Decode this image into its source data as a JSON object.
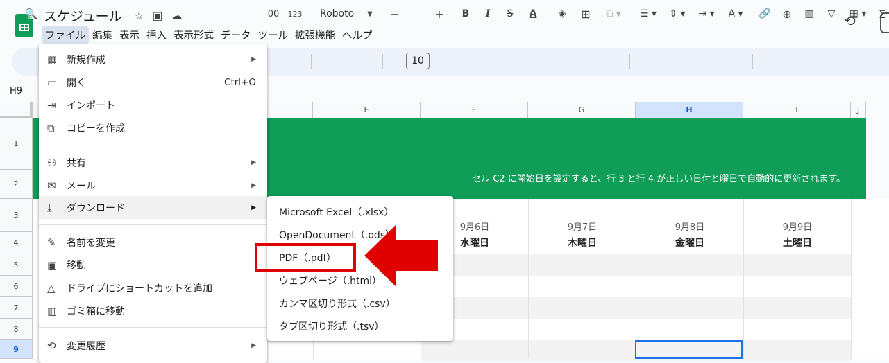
{
  "header": {
    "title": "スケジュール",
    "menus": [
      "ファイル",
      "編集",
      "表示",
      "挿入",
      "表示形式",
      "データ",
      "ツール",
      "拡張機能",
      "ヘルプ"
    ],
    "active_menu": "ファイル"
  },
  "toolbar": {
    "number_format": "123",
    "decimal_label": "00",
    "font": "Roboto",
    "font_size": "10",
    "minus": "−",
    "plus": "+"
  },
  "name_box": "H9",
  "columns": [
    "E",
    "F",
    "G",
    "H",
    "I",
    "J"
  ],
  "selected_column": "H",
  "rows": [
    "1",
    "2",
    "3",
    "4",
    "5",
    "6",
    "7",
    "8",
    "9"
  ],
  "selected_row": "9",
  "sheet": {
    "banner_text": "セル C2 に開始日を設定すると、行 3 と行 4 が正しい日付と曜日で自動的に更新されます。",
    "dates": [
      {
        "date": "9月6日",
        "weekday": "水曜日"
      },
      {
        "date": "9月7日",
        "weekday": "木曜日"
      },
      {
        "date": "9月8日",
        "weekday": "金曜日"
      },
      {
        "date": "9月9日",
        "weekday": "土曜日"
      }
    ]
  },
  "file_menu": {
    "new": "新規作成",
    "open": "開く",
    "open_shortcut": "Ctrl+O",
    "import": "インポート",
    "copy": "コピーを作成",
    "share": "共有",
    "email": "メール",
    "download": "ダウンロード",
    "rename": "名前を変更",
    "move": "移動",
    "shortcut": "ドライブにショートカットを追加",
    "trash": "ゴミ箱に移動",
    "history": "変更履歴"
  },
  "download_menu": {
    "xlsx": "Microsoft Excel（.xlsx）",
    "ods": "OpenDocument（.ods）",
    "pdf": "PDF（.pdf）",
    "html": "ウェブページ（.html）",
    "csv": "カンマ区切り形式（.csv）",
    "tsv": "タブ区切り形式（.tsv）"
  },
  "colors": {
    "banner": "#0f9d58",
    "highlight": "#e00000",
    "selection": "#1a73e8"
  }
}
